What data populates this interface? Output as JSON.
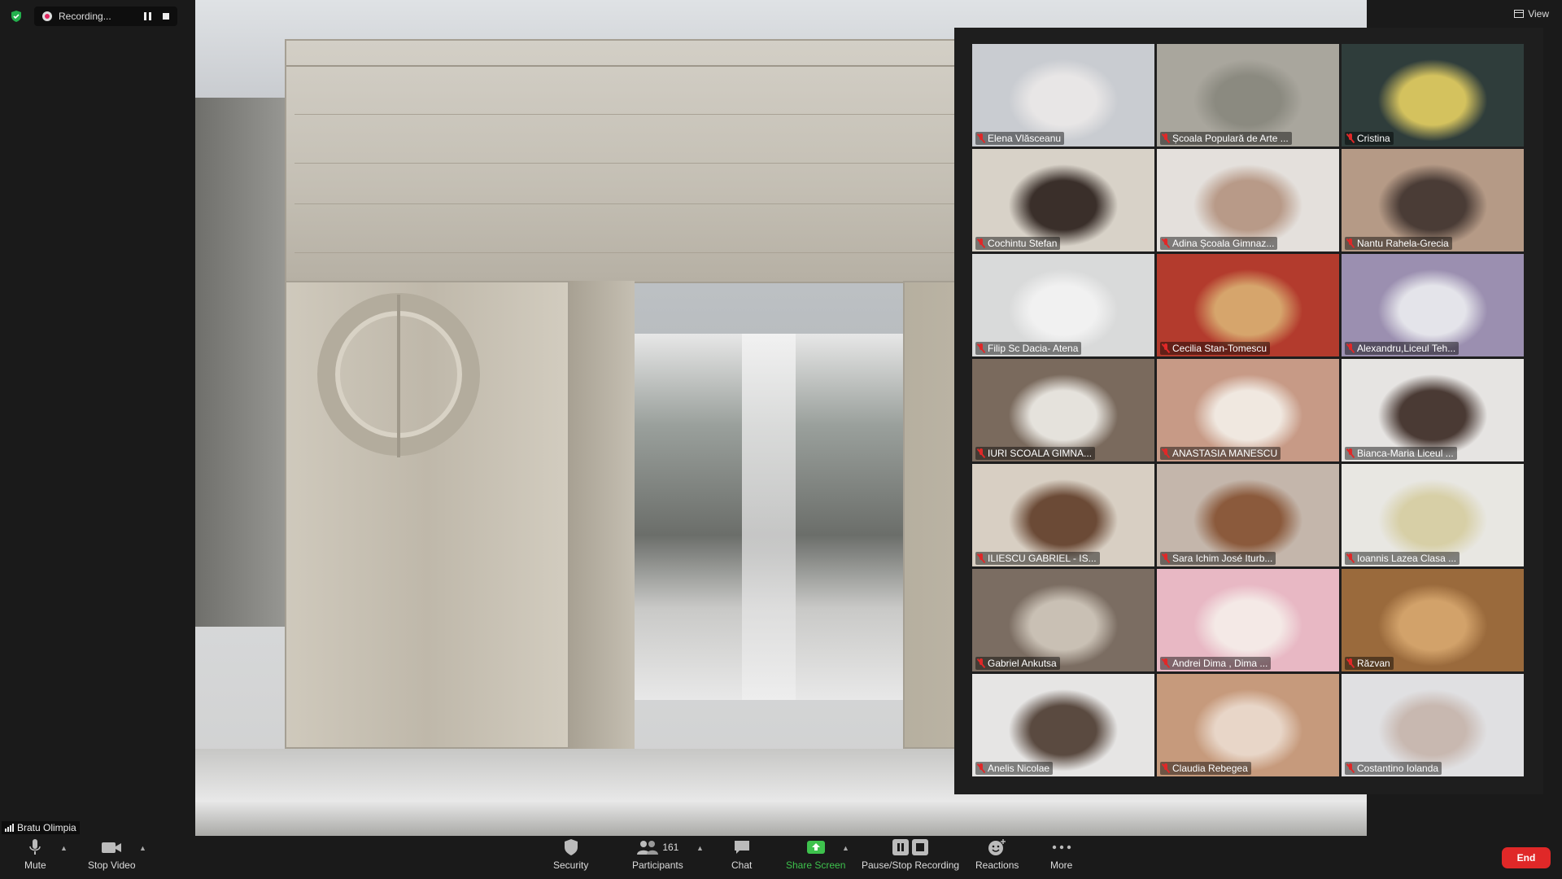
{
  "recording": {
    "label": "Recording..."
  },
  "view": {
    "label": "View"
  },
  "self": {
    "name": "Bratu Olimpia"
  },
  "participants": [
    {
      "name": "Elena Vlăsceanu",
      "bg": "#c9ccd1",
      "fg": "#e8e6e6"
    },
    {
      "name": "Școala Populară de Arte ...",
      "bg": "#a9a69d",
      "fg": "#8b8a80"
    },
    {
      "name": "Cristina",
      "bg": "#2f3d3b",
      "fg": "#d4c25e"
    },
    {
      "name": "Cochintu Stefan",
      "bg": "#d8d2c8",
      "fg": "#3a2f2a"
    },
    {
      "name": "Adina Școala Gimnaz...",
      "bg": "#e4e0dc",
      "fg": "#b89a88"
    },
    {
      "name": "Nantu Rahela-Grecia",
      "bg": "#b59a86",
      "fg": "#4a3c36"
    },
    {
      "name": "Filip Sc Dacia- Atena",
      "bg": "#d9dada",
      "fg": "#f1f1f1"
    },
    {
      "name": "Cecilia Stan-Tomescu",
      "bg": "#b33b2d",
      "fg": "#d6a56c"
    },
    {
      "name": "Alexandru,Liceul Teh...",
      "bg": "#9b8fb0",
      "fg": "#e4e4ea"
    },
    {
      "name": "IURI SCOALA GIMNA...",
      "bg": "#7a6a5d",
      "fg": "#e5e2dc"
    },
    {
      "name": "ANASTASIA MANESCU",
      "bg": "#c79a86",
      "fg": "#f0e8e0"
    },
    {
      "name": "Bianca-Maria Liceul ...",
      "bg": "#e6e4e2",
      "fg": "#4a3a34"
    },
    {
      "name": "ILIESCU GABRIEL - IS...",
      "bg": "#d8cfc3",
      "fg": "#6b4a36"
    },
    {
      "name": "Sara Ichim José Iturb...",
      "bg": "#c4b6ab",
      "fg": "#8b5a3c"
    },
    {
      "name": "Ioannis Lazea Clasa ...",
      "bg": "#e8e7e2",
      "fg": "#d7cfa6"
    },
    {
      "name": "Gabriel Ankutsa",
      "bg": "#7b6d62",
      "fg": "#c9c0b4"
    },
    {
      "name": "Andrei Dima , Dima ...",
      "bg": "#e8b8c4",
      "fg": "#f4e9e6"
    },
    {
      "name": "Răzvan",
      "bg": "#9a6a3c",
      "fg": "#d2a26a"
    },
    {
      "name": "Anelis Nicolae",
      "bg": "#e6e5e4",
      "fg": "#5a4a40"
    },
    {
      "name": "Claudia Rebegea",
      "bg": "#c69a7c",
      "fg": "#e8d6c8"
    },
    {
      "name": "Costantino Iolanda",
      "bg": "#e0e0e2",
      "fg": "#c8b8b0"
    }
  ],
  "toolbar": {
    "mute": "Mute",
    "stop_video": "Stop Video",
    "security": "Security",
    "participants": "Participants",
    "participant_count": "161",
    "chat": "Chat",
    "share_screen": "Share Screen",
    "pause_stop_recording": "Pause/Stop Recording",
    "reactions": "Reactions",
    "more": "More",
    "end": "End"
  },
  "colors": {
    "share_green": "#3ec24d",
    "end_red": "#e02828",
    "mute_red": "#e02828"
  }
}
